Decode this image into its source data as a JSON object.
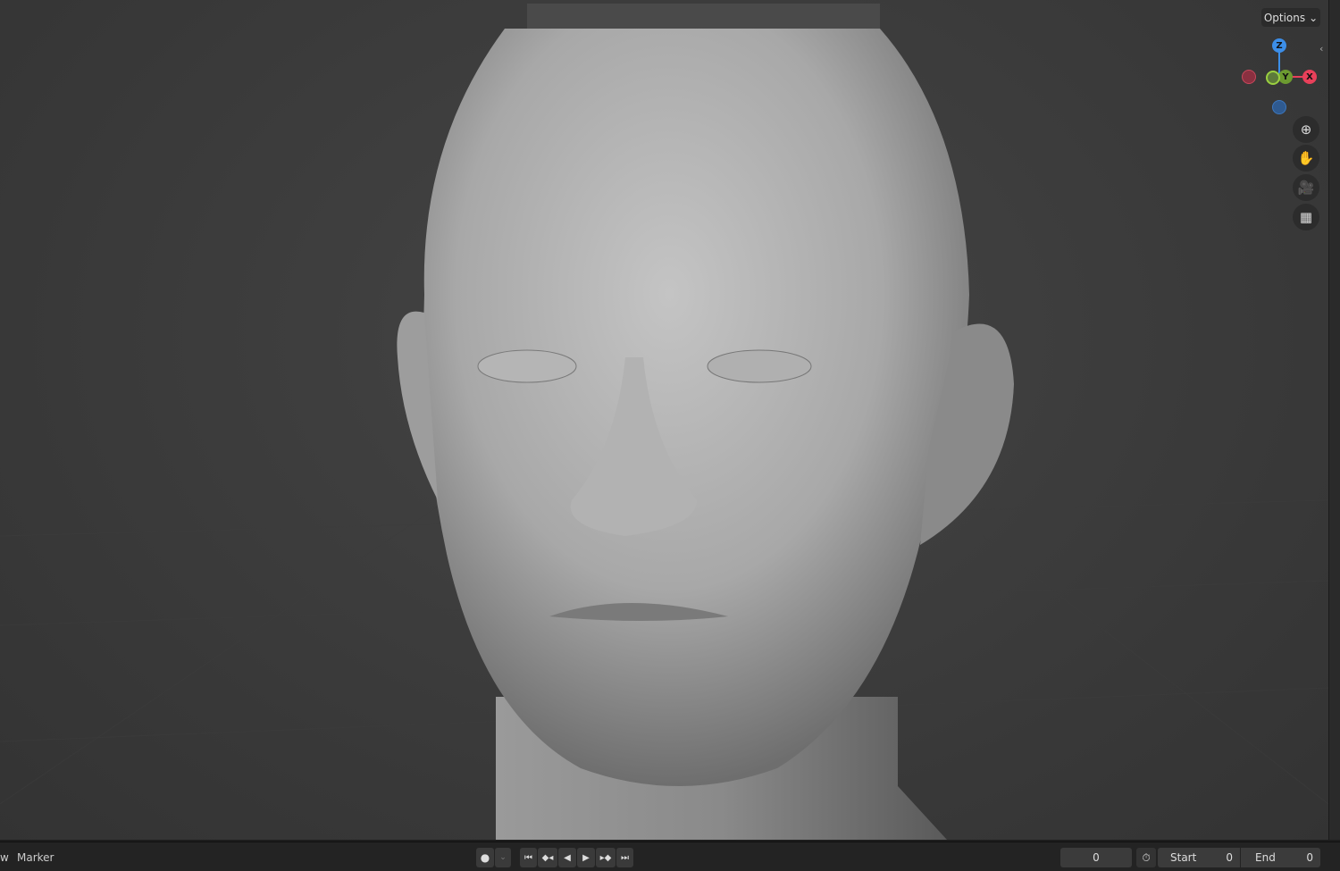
{
  "viewport": {
    "options_label": "Options",
    "gizmo": {
      "x": "X",
      "y": "Y",
      "z": "Z"
    },
    "nav_icons": [
      "zoom-icon",
      "hand-pan-icon",
      "camera-icon",
      "perspective-grid-icon"
    ],
    "colors": {
      "x": "#e8405a",
      "y": "#8bc43f",
      "z": "#3c8ee8"
    }
  },
  "timeline": {
    "menu_view": "w",
    "menu_marker": "Marker",
    "current_frame": "0",
    "start_label": "Start",
    "start_value": "0",
    "end_label": "End",
    "end_value": "0"
  }
}
